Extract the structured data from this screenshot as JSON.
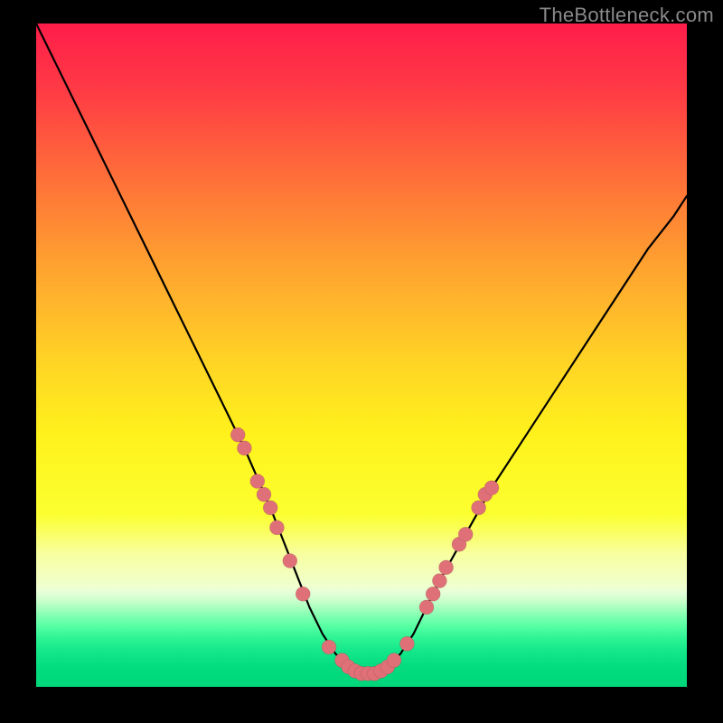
{
  "watermark": {
    "text": "TheBottleneck.com"
  },
  "chart_data": {
    "type": "line",
    "title": "",
    "xlabel": "",
    "ylabel": "",
    "xlim": [
      0,
      100
    ],
    "ylim": [
      0,
      100
    ],
    "legend": false,
    "grid": false,
    "background": "rainbow-vertical (red top → green bottom)",
    "series": [
      {
        "name": "bottleneck-curve",
        "x": [
          0,
          4,
          8,
          12,
          16,
          20,
          24,
          28,
          32,
          36,
          38,
          40,
          42,
          44,
          46,
          48,
          50,
          52,
          54,
          56,
          58,
          60,
          62,
          66,
          70,
          74,
          78,
          82,
          86,
          90,
          94,
          98,
          100
        ],
        "y": [
          100,
          92,
          84,
          76,
          68,
          60,
          52,
          44,
          36,
          27,
          22,
          17,
          12,
          8,
          5,
          3,
          2,
          2,
          3,
          5,
          8,
          12,
          16,
          23,
          30,
          36,
          42,
          48,
          54,
          60,
          66,
          71,
          74
        ]
      }
    ],
    "markers": {
      "name": "highlighted-points",
      "color": "#e07078",
      "radius_px": 8,
      "points": [
        {
          "x": 31,
          "y": 38
        },
        {
          "x": 32,
          "y": 36
        },
        {
          "x": 34,
          "y": 31
        },
        {
          "x": 35,
          "y": 29
        },
        {
          "x": 36,
          "y": 27
        },
        {
          "x": 37,
          "y": 24
        },
        {
          "x": 39,
          "y": 19
        },
        {
          "x": 41,
          "y": 14
        },
        {
          "x": 45,
          "y": 6
        },
        {
          "x": 47,
          "y": 4
        },
        {
          "x": 48,
          "y": 3
        },
        {
          "x": 49,
          "y": 2.4
        },
        {
          "x": 50,
          "y": 2
        },
        {
          "x": 51,
          "y": 2
        },
        {
          "x": 52,
          "y": 2
        },
        {
          "x": 53,
          "y": 2.4
        },
        {
          "x": 54,
          "y": 3
        },
        {
          "x": 55,
          "y": 4
        },
        {
          "x": 57,
          "y": 6.5
        },
        {
          "x": 60,
          "y": 12
        },
        {
          "x": 61,
          "y": 14
        },
        {
          "x": 62,
          "y": 16
        },
        {
          "x": 63,
          "y": 18
        },
        {
          "x": 65,
          "y": 21.5
        },
        {
          "x": 66,
          "y": 23
        },
        {
          "x": 68,
          "y": 27
        },
        {
          "x": 69,
          "y": 29
        },
        {
          "x": 70,
          "y": 30
        }
      ]
    }
  }
}
